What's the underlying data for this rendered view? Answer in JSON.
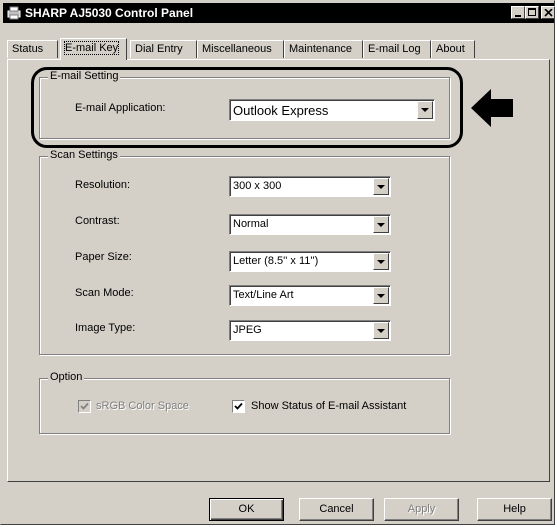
{
  "window": {
    "title": "SHARP AJ5030 Control Panel"
  },
  "tabs": [
    {
      "label": "Status"
    },
    {
      "label": "E-mail Key"
    },
    {
      "label": "Dial Entry"
    },
    {
      "label": "Miscellaneous"
    },
    {
      "label": "Maintenance"
    },
    {
      "label": "E-mail Log"
    },
    {
      "label": "About"
    }
  ],
  "active_tab": "E-mail Key",
  "email_setting": {
    "group_title": "E-mail Setting",
    "app_label": "E-mail Application:",
    "app_value": "Outlook Express"
  },
  "scan_settings": {
    "group_title": "Scan Settings",
    "fields": [
      {
        "label": "Resolution:",
        "value": "300 x 300"
      },
      {
        "label": "Contrast:",
        "value": "Normal"
      },
      {
        "label": "Paper Size:",
        "value": "Letter (8.5'' x 11'')"
      },
      {
        "label": "Scan Mode:",
        "value": "Text/Line Art"
      },
      {
        "label": "Image Type:",
        "value": "JPEG"
      }
    ]
  },
  "option": {
    "group_title": "Option",
    "srgb_label": "sRGB Color Space",
    "srgb_checked": true,
    "srgb_enabled": false,
    "assistant_label": "Show Status of E-mail Assistant",
    "assistant_checked": true
  },
  "buttons": {
    "ok": "OK",
    "cancel": "Cancel",
    "apply": "Apply",
    "help": "Help"
  },
  "icons": {
    "app_icon": "printer-app-icon",
    "callout": "left-arrow-callout-icon"
  },
  "colors": {
    "titlebar": "#000000",
    "face": "#d4d0c8",
    "shadow": "#808080"
  }
}
